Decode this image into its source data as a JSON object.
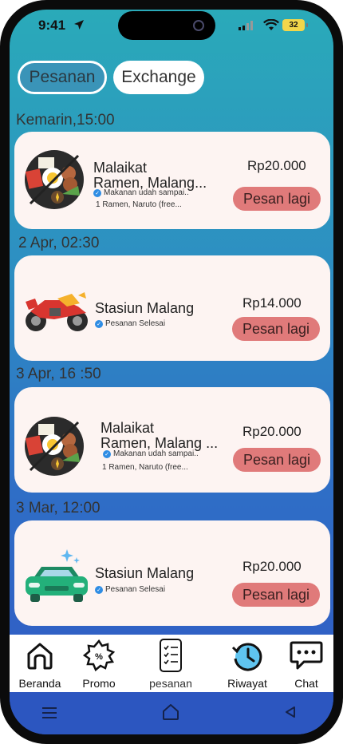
{
  "status_bar": {
    "time": "9:41",
    "battery": "32"
  },
  "tabs": [
    {
      "label": "Pesanan"
    },
    {
      "label": "Exchange"
    }
  ],
  "orders": [
    {
      "date": "Kemarin,15:00",
      "name_line1": "Malaikat",
      "name_line2": "Ramen, Malang...",
      "status": "Makanan udah sampai..",
      "detail": "1 Ramen, Naruto (free...",
      "price": "Rp20.000",
      "button": "Pesan lagi",
      "icon": "ramen-bowl-icon"
    },
    {
      "date": "2 Apr, 02:30",
      "name_line1": "Stasiun Malang",
      "status": "Pesanan Selesai",
      "price": "Rp14.000",
      "button": "Pesan lagi",
      "icon": "motorcycle-icon"
    },
    {
      "date": "3 Apr, 16 :50",
      "name_line1": "Malaikat",
      "name_line2": "Ramen, Malang ...",
      "status": "Makanan udah sampai..",
      "detail": "1 Ramen, Naruto (free...",
      "price": "Rp20.000",
      "button": "Pesan lagi",
      "icon": "ramen-bowl-icon"
    },
    {
      "date": "3 Mar, 12:00",
      "name_line1": "Stasiun Malang",
      "status": "Pesanan Selesai",
      "price": "Rp20.000",
      "button": "Pesan lagi",
      "icon": "car-icon"
    }
  ],
  "bottom_nav": [
    {
      "label": "Beranda",
      "icon": "home-icon"
    },
    {
      "label": "Promo",
      "icon": "promo-badge-icon"
    },
    {
      "label": "pesanan",
      "icon": "order-list-icon"
    },
    {
      "label": "Riwayat",
      "icon": "history-icon"
    },
    {
      "label": "Chat",
      "icon": "chat-icon"
    }
  ],
  "system_nav": [
    "menu-icon",
    "home-outline-icon",
    "back-icon"
  ]
}
